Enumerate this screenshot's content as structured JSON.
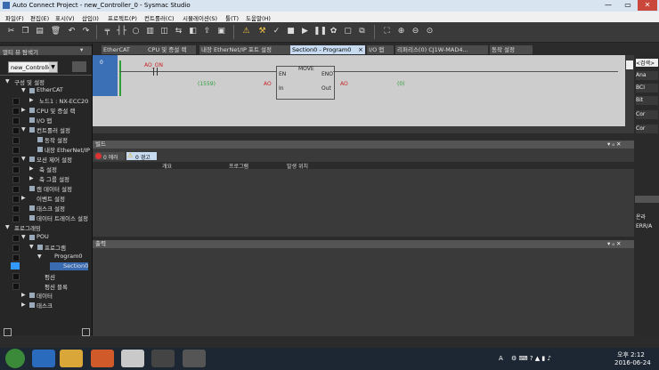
{
  "window": {
    "title": "Auto Connect Project - new_Controller_0 - Sysmac Studio",
    "minimize": "—",
    "restore": "▭",
    "close": "✕"
  },
  "menu": [
    "파일(F)",
    "편집(E)",
    "표시(V)",
    "삽입(I)",
    "프로젝트(P)",
    "컨트롤러(C)",
    "시뮬레이션(S)",
    "툴(T)",
    "도움말(H)"
  ],
  "left_panel": {
    "title": "멀티 뷰 탐색기",
    "controller_select": "new_Controlle",
    "tree": [
      "구성 및 설정",
      "EtherCAT",
      "노드1 : NX-ECC20",
      "CPU 및 증설 랙",
      "I/O 맵",
      "컨트롤러 설정",
      "동작 설정",
      "내장 EtherNet/IP",
      "모션 제어 설정",
      "축 설정",
      "축 그룹 설정",
      "캠 데이터 설정",
      "이벤트 설정",
      "태스크 설정",
      "데이터 트레이스 설정",
      "프로그래밍",
      "POU",
      "프로그램",
      "Program0",
      "Section0",
      "펑션",
      "펑션 블록",
      "데이터",
      "태스크"
    ]
  },
  "tabs": [
    "EtherCAT",
    "CPU 및 증설 랙",
    "내장 EtherNet/IP 포트 설정",
    "Section0 - Program0",
    "I/O 맵",
    "리퍼리스(0) CJ1W-MAD4...",
    "동작 설정"
  ],
  "tab_close": "×",
  "ladder": {
    "rung_number": "0",
    "contact_var": "AO_ON",
    "block_name": "MOVE",
    "en": "EN",
    "eno": "ENO",
    "in": "In",
    "out": "Out",
    "in_value": "(1559)",
    "in_var": "AO",
    "out_var": "AO",
    "out_value": "(0)"
  },
  "build_panel": {
    "title": "빌드",
    "errors": "0 에러",
    "warnings": "0 경고",
    "columns": [
      "개요",
      "프로그램",
      "발생 위치"
    ],
    "pin": "▾ ₀ ✕"
  },
  "output_panel": {
    "title": "출력",
    "pin": "▾ ₀ ✕"
  },
  "right_panel": {
    "search": "<검색>",
    "items": [
      "Ana",
      "BCI",
      "Bit",
      "Cor",
      "Cor"
    ],
    "bottom_items": [
      "온라",
      "ERR/A"
    ]
  },
  "taskbar": {
    "lang": "A",
    "time": "오후 2:12",
    "date": "2016-06-24"
  },
  "colors": {
    "accent": "#3399ff",
    "ladder_bg": "#cdcdcd",
    "rail": "#2e9e3a",
    "var_red": "#cc2222",
    "value_green": "#2e9e3a"
  }
}
